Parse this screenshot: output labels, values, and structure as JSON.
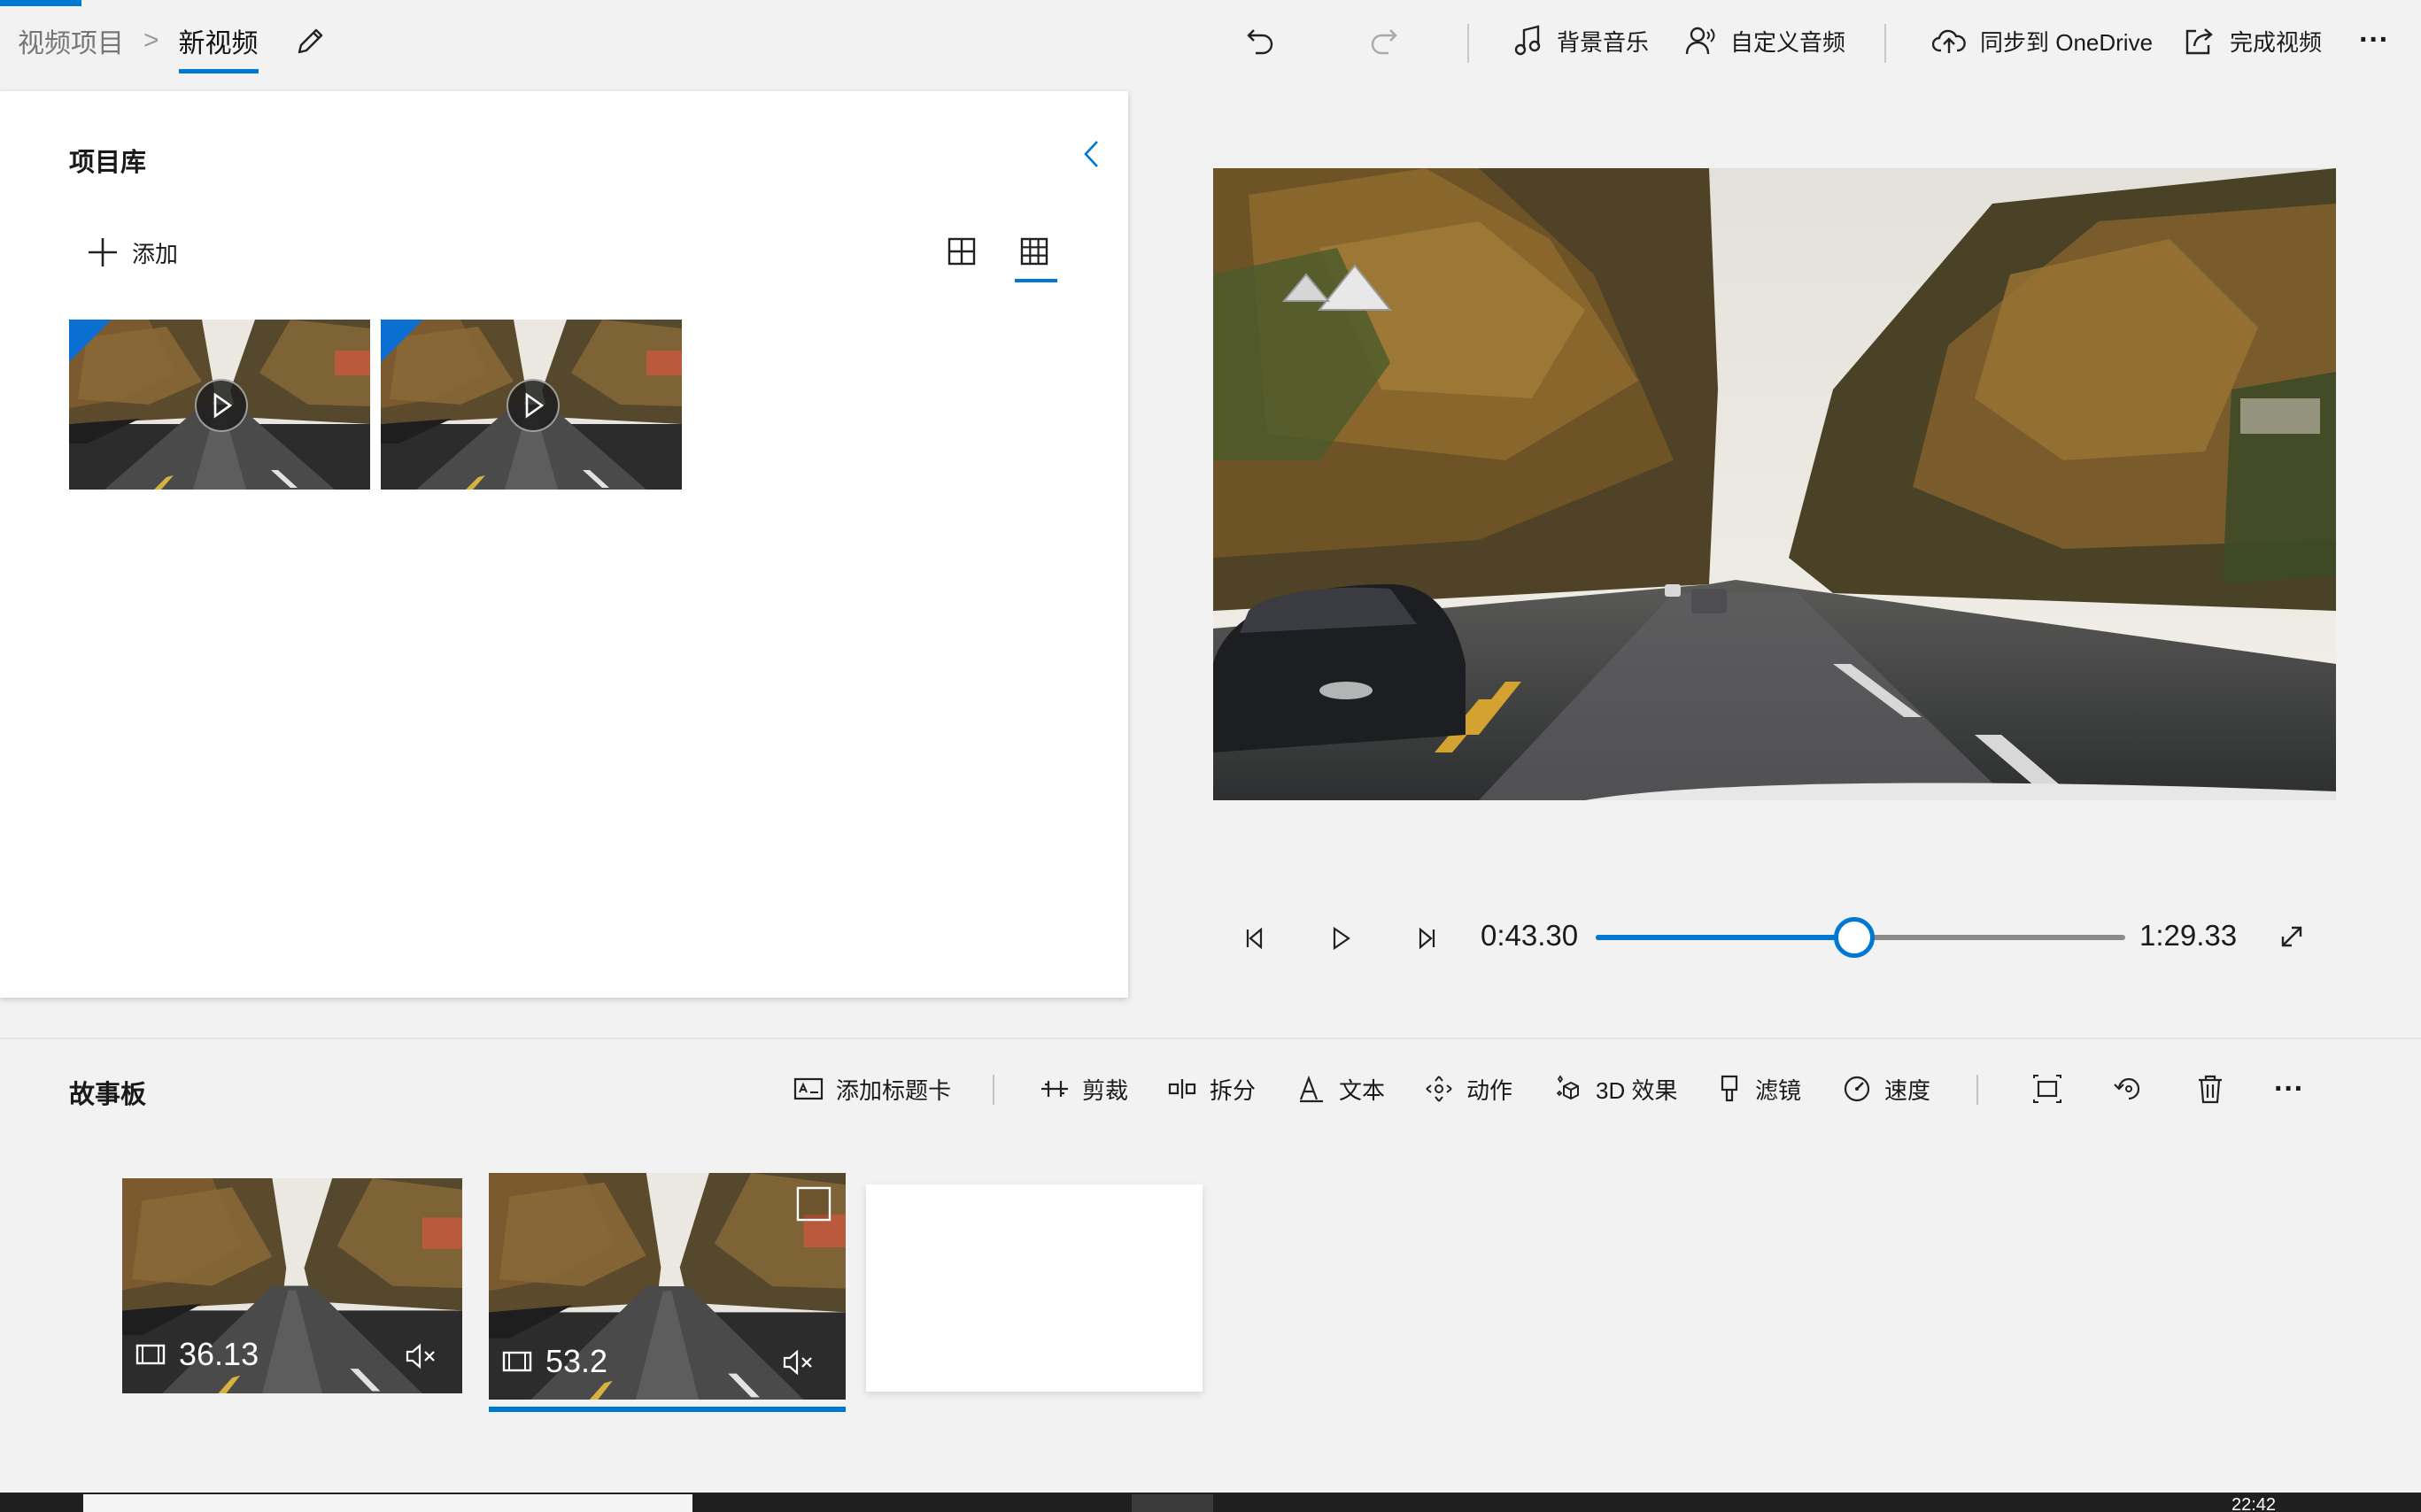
{
  "breadcrumb": {
    "root": "视频项目",
    "separator": ">",
    "current": "新视频"
  },
  "toolbar": {
    "undo_icon": "undo-icon",
    "redo_icon": "redo-icon",
    "background_music": "背景音乐",
    "custom_audio": "自定义音频",
    "sync_onedrive": "同步到 OneDrive",
    "finish_video": "完成视频",
    "more": "···"
  },
  "library": {
    "title": "项目库",
    "add_label": "添加",
    "collapse_icon": "chevron-left-icon",
    "view_modes": [
      "large-grid-icon",
      "small-grid-icon"
    ],
    "selected_view": "small-grid-icon",
    "items": [
      {
        "kind": "video",
        "icon": "play-icon"
      },
      {
        "kind": "video",
        "icon": "play-icon"
      }
    ]
  },
  "player": {
    "current_time": "0:43.30",
    "total_time": "1:29.33",
    "progress": 0.488,
    "controls": [
      "previous-frame-icon",
      "play-icon",
      "next-frame-icon",
      "fullscreen-icon"
    ]
  },
  "storyboard": {
    "title": "故事板",
    "tools": {
      "add_title_card": "添加标题卡",
      "trim": "剪裁",
      "split": "拆分",
      "text": "文本",
      "motion": "动作",
      "effects_3d": "3D 效果",
      "filters": "滤镜",
      "speed": "速度"
    },
    "extra_actions": [
      "crop-resize-icon",
      "rotate-icon",
      "delete-icon"
    ],
    "more": "···",
    "clips": [
      {
        "duration": "36.13",
        "muted": true,
        "selected": false
      },
      {
        "duration": "53.2",
        "muted": true,
        "selected": true
      }
    ]
  },
  "taskbar": {
    "clock": "22:42"
  },
  "colors": {
    "accent": "#0078d4",
    "panel": "#ffffff",
    "background": "#f2f2f2"
  }
}
